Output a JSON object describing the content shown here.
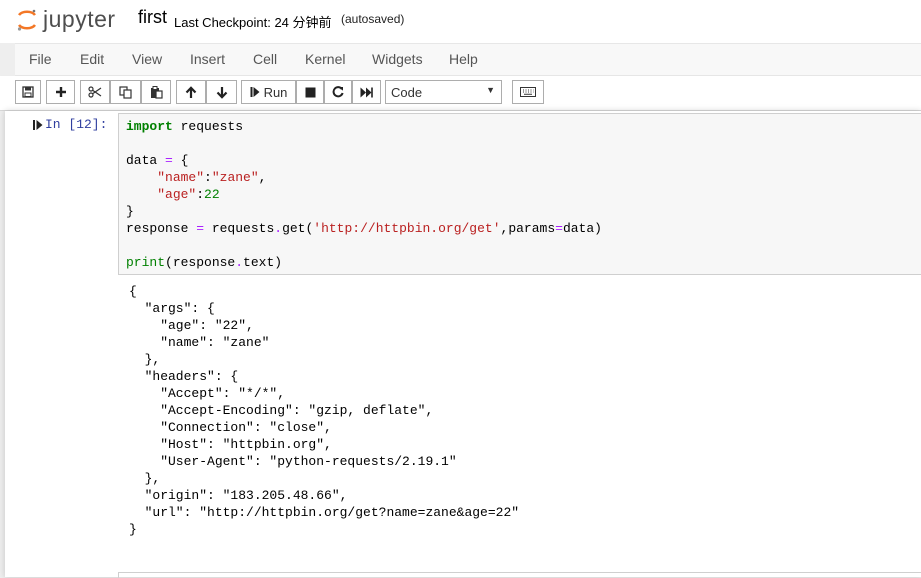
{
  "header": {
    "logo_text": "jupyter",
    "notebook_name": "first",
    "checkpoint": "Last Checkpoint: 24 分钟前",
    "autosave": "(autosaved)"
  },
  "menu": [
    "File",
    "Edit",
    "View",
    "Insert",
    "Cell",
    "Kernel",
    "Widgets",
    "Help"
  ],
  "toolbar": {
    "run_label": "Run",
    "cell_type": "Code",
    "icons": [
      "save-icon",
      "plus-icon",
      "cut-icon",
      "copy-icon",
      "paste-icon",
      "arrow-up-icon",
      "arrow-down-icon",
      "step-forward-icon",
      "stop-icon",
      "restart-icon",
      "fast-forward-icon",
      "keyboard-icon"
    ]
  },
  "cell": {
    "prompt": "In [12]:",
    "code": {
      "l1_kw": "import",
      "l1_rest": " requests",
      "l3_a": "data ",
      "l3_eq": "=",
      "l3_b": " {",
      "l4_indent": "    ",
      "l4_k": "\"name\"",
      "l4_c": ":",
      "l4_v": "\"zane\"",
      "l4_end": ",",
      "l5_indent": "    ",
      "l5_k": "\"age\"",
      "l5_c": ":",
      "l5_v": "22",
      "l6": "}",
      "l7_a": "response ",
      "l7_eq": "=",
      "l7_b": " requests",
      "l7_dot": ".",
      "l7_c": "get(",
      "l7_url": "'http://httpbin.org/get'",
      "l7_d": ",params",
      "l7_eq2": "=",
      "l7_e": "data)",
      "l9_fn": "print",
      "l9_a": "(response",
      "l9_dot": ".",
      "l9_b": "text)"
    },
    "output": "{\n  \"args\": {\n    \"age\": \"22\",\n    \"name\": \"zane\"\n  },\n  \"headers\": {\n    \"Accept\": \"*/*\",\n    \"Accept-Encoding\": \"gzip, deflate\",\n    \"Connection\": \"close\",\n    \"Host\": \"httpbin.org\",\n    \"User-Agent\": \"python-requests/2.19.1\"\n  },\n  \"origin\": \"183.205.48.66\",\n  \"url\": \"http://httpbin.org/get?name=zane&age=22\"\n}"
  },
  "colors": {
    "logo_orange": "#f37726",
    "prompt_blue": "#303f9f",
    "keyword_green": "#008000",
    "string_red": "#ba2121",
    "operator_purple": "#aa22ff"
  }
}
